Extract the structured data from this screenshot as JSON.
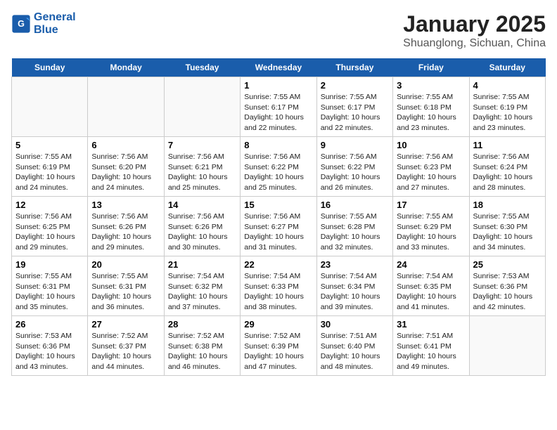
{
  "header": {
    "logo_line1": "General",
    "logo_line2": "Blue",
    "title": "January 2025",
    "subtitle": "Shuanglong, Sichuan, China"
  },
  "days": [
    "Sunday",
    "Monday",
    "Tuesday",
    "Wednesday",
    "Thursday",
    "Friday",
    "Saturday"
  ],
  "weeks": [
    [
      {
        "num": "",
        "info": ""
      },
      {
        "num": "",
        "info": ""
      },
      {
        "num": "",
        "info": ""
      },
      {
        "num": "1",
        "info": "Sunrise: 7:55 AM\nSunset: 6:17 PM\nDaylight: 10 hours and 22 minutes."
      },
      {
        "num": "2",
        "info": "Sunrise: 7:55 AM\nSunset: 6:17 PM\nDaylight: 10 hours and 22 minutes."
      },
      {
        "num": "3",
        "info": "Sunrise: 7:55 AM\nSunset: 6:18 PM\nDaylight: 10 hours and 23 minutes."
      },
      {
        "num": "4",
        "info": "Sunrise: 7:55 AM\nSunset: 6:19 PM\nDaylight: 10 hours and 23 minutes."
      }
    ],
    [
      {
        "num": "5",
        "info": "Sunrise: 7:55 AM\nSunset: 6:19 PM\nDaylight: 10 hours and 24 minutes."
      },
      {
        "num": "6",
        "info": "Sunrise: 7:56 AM\nSunset: 6:20 PM\nDaylight: 10 hours and 24 minutes."
      },
      {
        "num": "7",
        "info": "Sunrise: 7:56 AM\nSunset: 6:21 PM\nDaylight: 10 hours and 25 minutes."
      },
      {
        "num": "8",
        "info": "Sunrise: 7:56 AM\nSunset: 6:22 PM\nDaylight: 10 hours and 25 minutes."
      },
      {
        "num": "9",
        "info": "Sunrise: 7:56 AM\nSunset: 6:22 PM\nDaylight: 10 hours and 26 minutes."
      },
      {
        "num": "10",
        "info": "Sunrise: 7:56 AM\nSunset: 6:23 PM\nDaylight: 10 hours and 27 minutes."
      },
      {
        "num": "11",
        "info": "Sunrise: 7:56 AM\nSunset: 6:24 PM\nDaylight: 10 hours and 28 minutes."
      }
    ],
    [
      {
        "num": "12",
        "info": "Sunrise: 7:56 AM\nSunset: 6:25 PM\nDaylight: 10 hours and 29 minutes."
      },
      {
        "num": "13",
        "info": "Sunrise: 7:56 AM\nSunset: 6:26 PM\nDaylight: 10 hours and 29 minutes."
      },
      {
        "num": "14",
        "info": "Sunrise: 7:56 AM\nSunset: 6:26 PM\nDaylight: 10 hours and 30 minutes."
      },
      {
        "num": "15",
        "info": "Sunrise: 7:56 AM\nSunset: 6:27 PM\nDaylight: 10 hours and 31 minutes."
      },
      {
        "num": "16",
        "info": "Sunrise: 7:55 AM\nSunset: 6:28 PM\nDaylight: 10 hours and 32 minutes."
      },
      {
        "num": "17",
        "info": "Sunrise: 7:55 AM\nSunset: 6:29 PM\nDaylight: 10 hours and 33 minutes."
      },
      {
        "num": "18",
        "info": "Sunrise: 7:55 AM\nSunset: 6:30 PM\nDaylight: 10 hours and 34 minutes."
      }
    ],
    [
      {
        "num": "19",
        "info": "Sunrise: 7:55 AM\nSunset: 6:31 PM\nDaylight: 10 hours and 35 minutes."
      },
      {
        "num": "20",
        "info": "Sunrise: 7:55 AM\nSunset: 6:31 PM\nDaylight: 10 hours and 36 minutes."
      },
      {
        "num": "21",
        "info": "Sunrise: 7:54 AM\nSunset: 6:32 PM\nDaylight: 10 hours and 37 minutes."
      },
      {
        "num": "22",
        "info": "Sunrise: 7:54 AM\nSunset: 6:33 PM\nDaylight: 10 hours and 38 minutes."
      },
      {
        "num": "23",
        "info": "Sunrise: 7:54 AM\nSunset: 6:34 PM\nDaylight: 10 hours and 39 minutes."
      },
      {
        "num": "24",
        "info": "Sunrise: 7:54 AM\nSunset: 6:35 PM\nDaylight: 10 hours and 41 minutes."
      },
      {
        "num": "25",
        "info": "Sunrise: 7:53 AM\nSunset: 6:36 PM\nDaylight: 10 hours and 42 minutes."
      }
    ],
    [
      {
        "num": "26",
        "info": "Sunrise: 7:53 AM\nSunset: 6:36 PM\nDaylight: 10 hours and 43 minutes."
      },
      {
        "num": "27",
        "info": "Sunrise: 7:52 AM\nSunset: 6:37 PM\nDaylight: 10 hours and 44 minutes."
      },
      {
        "num": "28",
        "info": "Sunrise: 7:52 AM\nSunset: 6:38 PM\nDaylight: 10 hours and 46 minutes."
      },
      {
        "num": "29",
        "info": "Sunrise: 7:52 AM\nSunset: 6:39 PM\nDaylight: 10 hours and 47 minutes."
      },
      {
        "num": "30",
        "info": "Sunrise: 7:51 AM\nSunset: 6:40 PM\nDaylight: 10 hours and 48 minutes."
      },
      {
        "num": "31",
        "info": "Sunrise: 7:51 AM\nSunset: 6:41 PM\nDaylight: 10 hours and 49 minutes."
      },
      {
        "num": "",
        "info": ""
      }
    ]
  ]
}
